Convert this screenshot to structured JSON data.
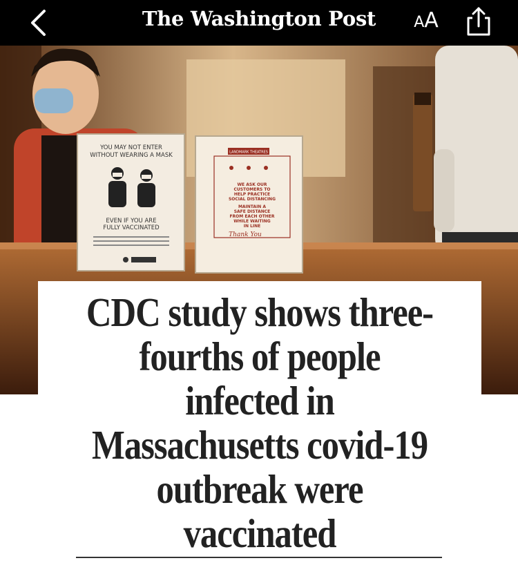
{
  "header": {
    "masthead": "The Washington Post",
    "text_size_label_small": "A",
    "text_size_label_big": "A"
  },
  "hero": {
    "sign_left": {
      "line1": "YOU MAY NOT ENTER",
      "line2": "WITHOUT WEARING A MASK",
      "line3": "EVEN IF YOU ARE",
      "line4": "FULLY VACCINATED"
    },
    "sign_right": {
      "brand": "LANDMARK THEATRES",
      "line1": "WE ASK OUR",
      "line2": "CUSTOMERS TO",
      "line3": "HELP PRACTICE",
      "line4": "SOCIAL DISTANCING",
      "line5": "MAINTAIN A",
      "line6": "SAFE DISTANCE",
      "line7": "FROM EACH OTHER",
      "line8": "WHILE WAITING",
      "line9": "IN LINE",
      "signoff": "Thank You"
    }
  },
  "article": {
    "headline_lines": [
      "CDC study shows three-",
      "fourths of people",
      "infected in",
      "Massachusetts covid-19",
      "outbreak were",
      "vaccinated"
    ]
  },
  "colors": {
    "topbar": "#000000",
    "headline_text": "#222222",
    "hero_wood": "#8e5a2b"
  }
}
